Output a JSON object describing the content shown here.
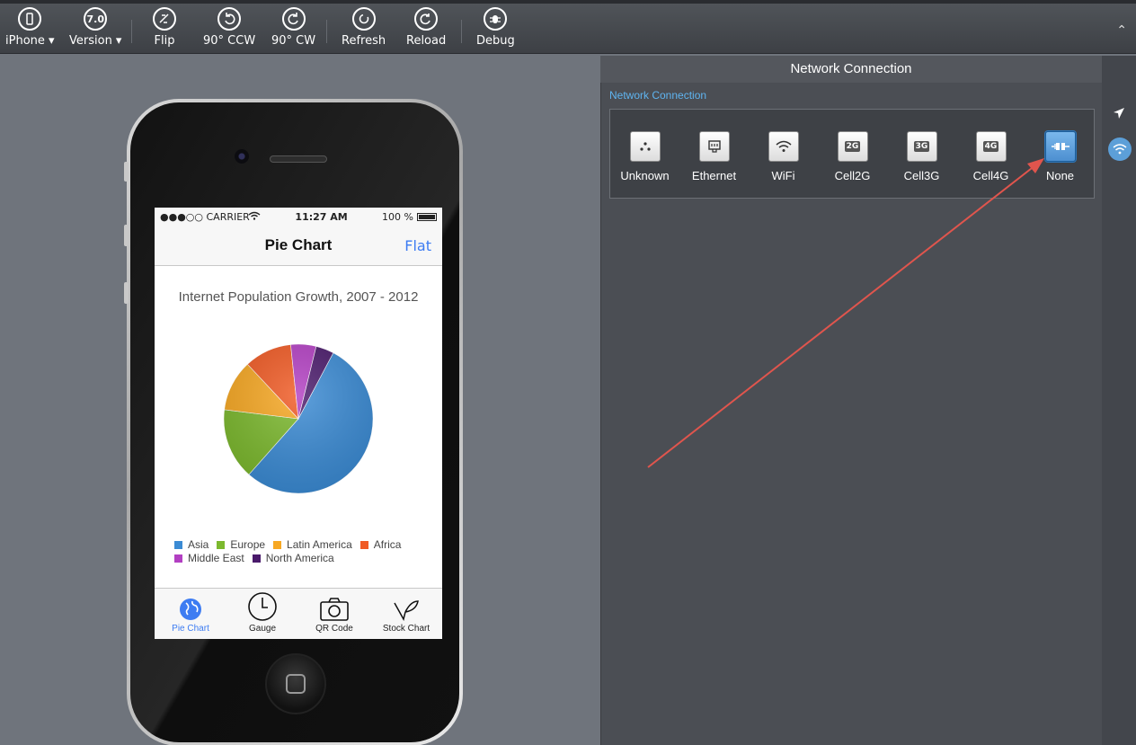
{
  "toolbar": {
    "buttons": [
      {
        "id": "device",
        "label": "iPhone ▾",
        "icon": "phone-icon"
      },
      {
        "id": "version",
        "label": "Version ▾",
        "icon_text": "7.0"
      },
      {
        "id": "flip",
        "label": "Flip",
        "icon": "flip-icon"
      },
      {
        "id": "rotate_ccw",
        "label": "90° CCW",
        "icon": "rotate-ccw-icon"
      },
      {
        "id": "rotate_cw",
        "label": "90° CW",
        "icon": "rotate-cw-icon"
      },
      {
        "id": "refresh",
        "label": "Refresh",
        "icon": "refresh-icon"
      },
      {
        "id": "reload",
        "label": "Reload",
        "icon": "reload-icon"
      },
      {
        "id": "debug",
        "label": "Debug",
        "icon": "bug-icon"
      }
    ],
    "collapse": "⌃"
  },
  "phone": {
    "status": {
      "carrier": "●●●○○ CARRIER",
      "time": "11:27 AM",
      "battery": "100 %"
    },
    "nav": {
      "title": "Pie Chart",
      "right": "Flat"
    },
    "chart_title": "Internet Population Growth, 2007 - 2012",
    "tabs": [
      {
        "label": "Pie Chart",
        "active": true
      },
      {
        "label": "Gauge",
        "active": false
      },
      {
        "label": "QR Code",
        "active": false
      },
      {
        "label": "Stock Chart",
        "active": false
      }
    ]
  },
  "chart_data": {
    "type": "pie",
    "title": "Internet Population Growth, 2007 - 2012",
    "categories": [
      "Asia",
      "Europe",
      "Latin America",
      "Africa",
      "Middle East",
      "North America"
    ],
    "values": [
      53.8,
      15.4,
      11.1,
      10.3,
      5.5,
      3.9
    ],
    "colors": [
      "#3b8bd4",
      "#7cb92e",
      "#f7a823",
      "#f05a24",
      "#b23fc2",
      "#4a1a6b"
    ],
    "legend_placement": "bottom"
  },
  "panel": {
    "title": "Network Connection",
    "section_label": "Network Connection",
    "options": [
      {
        "label": "Unknown",
        "icon": "unknown-icon",
        "selected": false
      },
      {
        "label": "Ethernet",
        "icon": "ethernet-icon",
        "selected": false
      },
      {
        "label": "WiFi",
        "icon": "wifi-icon",
        "selected": false
      },
      {
        "label": "Cell2G",
        "icon": "cell2g-icon",
        "badge": "2G",
        "selected": false
      },
      {
        "label": "Cell3G",
        "icon": "cell3g-icon",
        "badge": "3G",
        "selected": false
      },
      {
        "label": "Cell4G",
        "icon": "cell4g-icon",
        "badge": "4G",
        "selected": false
      },
      {
        "label": "None",
        "icon": "plug-icon",
        "selected": true
      }
    ]
  },
  "colors": {
    "accent": "#3d7cf2",
    "section_label": "#5fb4f0",
    "arrow": "#e0554d"
  }
}
